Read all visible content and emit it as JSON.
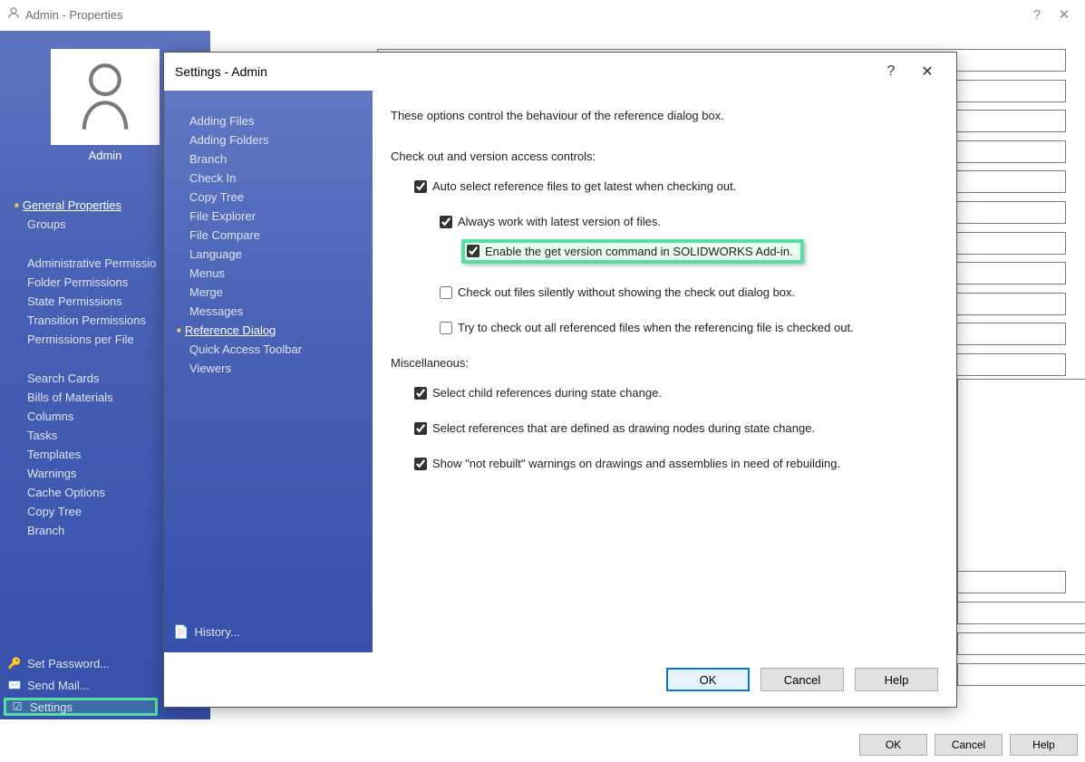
{
  "parent": {
    "title": "Admin - Properties",
    "avatar_label": "Admin",
    "nav": {
      "general": "General Properties",
      "groups": "Groups",
      "admin_perm": "Administrative Permissio",
      "folder_perm": "Folder Permissions",
      "state_perm": "State Permissions",
      "trans_perm": "Transition Permissions",
      "file_perm": "Permissions per File",
      "search_cards": "Search Cards",
      "bom": "Bills of Materials",
      "columns": "Columns",
      "tasks": "Tasks",
      "templates": "Templates",
      "warnings": "Warnings",
      "cache": "Cache Options",
      "copy_tree": "Copy Tree",
      "branch": "Branch"
    },
    "bottom": {
      "password": "Set Password...",
      "mail": "Send Mail...",
      "settings": "Settings"
    },
    "buttons": {
      "ok": "OK",
      "cancel": "Cancel",
      "help": "Help"
    }
  },
  "dialog": {
    "title": "Settings - Admin",
    "nav": [
      "Adding Files",
      "Adding Folders",
      "Branch",
      "Check In",
      "Copy Tree",
      "File Explorer",
      "File Compare",
      "Language",
      "Menus",
      "Merge",
      "Messages",
      "Reference Dialog",
      "Quick Access Toolbar",
      "Viewers"
    ],
    "history": "History...",
    "content": {
      "desc": "These options control the behaviour of the reference dialog box.",
      "section1": "Check out and version access controls:",
      "cb1": "Auto select reference files to get latest when checking out.",
      "cb2": "Always work with latest version of files.",
      "cb3": "Enable the get version command in SOLIDWORKS Add-in.",
      "cb4": "Check out files silently without showing the check out dialog box.",
      "cb5": "Try to check out all referenced files when the referencing file is checked out.",
      "section2": "Miscellaneous:",
      "cb6": "Select child references during state change.",
      "cb7": "Select references that are defined as drawing nodes during state change.",
      "cb8": "Show \"not rebuilt\" warnings on drawings and assemblies in need of rebuilding."
    },
    "buttons": {
      "ok": "OK",
      "cancel": "Cancel",
      "help": "Help"
    }
  }
}
